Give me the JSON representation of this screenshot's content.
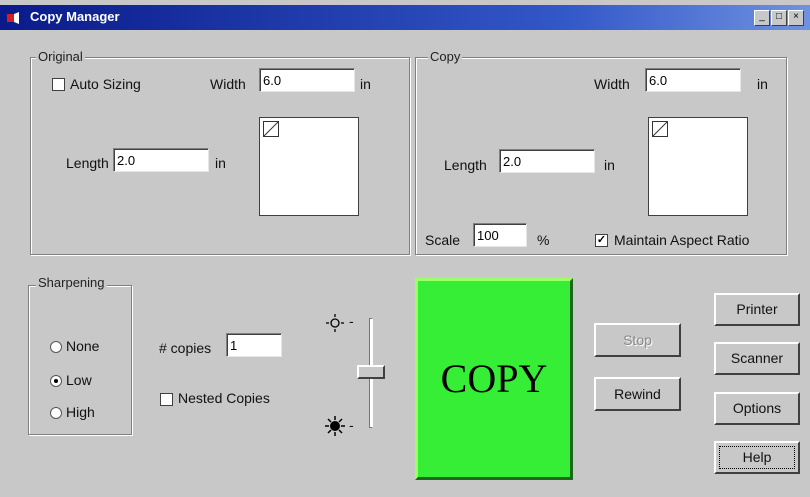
{
  "window": {
    "title": "Copy Manager",
    "controls": {
      "minimize": "_",
      "restore": "□",
      "close": "×"
    }
  },
  "original": {
    "label": "Original",
    "auto_sizing": {
      "label": "Auto Sizing",
      "checked": false
    },
    "width_label": "Width",
    "width_value": "6.0",
    "width_unit": "in",
    "length_label": "Length",
    "length_value": "2.0",
    "length_unit": "in"
  },
  "copy": {
    "label": "Copy",
    "width_label": "Width",
    "width_value": "6.0",
    "width_unit": "in",
    "length_label": "Length",
    "length_value": "2.0",
    "length_unit": "in",
    "scale_label": "Scale",
    "scale_value": "100",
    "scale_unit": "%",
    "aspect": {
      "label": "Maintain Aspect Ratio",
      "checked": true
    }
  },
  "sharpening": {
    "label": "Sharpening",
    "options": [
      {
        "label": "None",
        "selected": false
      },
      {
        "label": "Low",
        "selected": true
      },
      {
        "label": "High",
        "selected": false
      }
    ]
  },
  "copies": {
    "label": "# copies",
    "value": "1",
    "nested": {
      "label": "Nested Copies",
      "checked": false
    }
  },
  "brightness": {
    "bright_tick": "-",
    "dark_tick": "-",
    "level": 0.5
  },
  "actions": {
    "copy": "COPY",
    "stop": "Stop",
    "rewind": "Rewind"
  },
  "side_buttons": [
    "Printer",
    "Scanner",
    "Options",
    "Help"
  ],
  "colors": {
    "copy_button": "#35ee35",
    "title_bar": "#0a1a8a",
    "window": "#c8c8c8"
  }
}
